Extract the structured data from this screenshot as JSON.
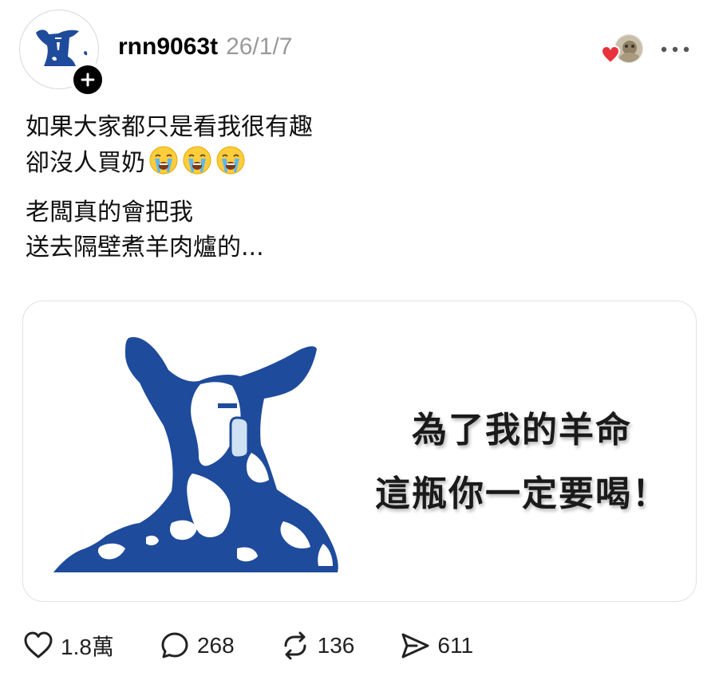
{
  "post": {
    "username": "rnn9063t",
    "timestamp": "26/1/7",
    "text_paragraphs": [
      {
        "lines": [
          "如果大家都只是看我很有趣",
          "卻沒人買奶"
        ],
        "emoji": "😭😭😭"
      },
      {
        "lines": [
          "老闆真的會把我",
          "送去隔壁煮羊肉爐的..."
        ]
      }
    ],
    "image_caption": [
      "為了我的羊命",
      "這瓶你一定要喝！"
    ]
  },
  "actions": {
    "like_count": "1.8萬",
    "reply_count": "268",
    "repost_count": "136",
    "share_count": "611"
  },
  "colors": {
    "brand_blue": "#1e4b9b",
    "heart_red": "#e8323c",
    "muted_text": "#9a9a9a"
  },
  "icons": [
    "goat-logo-icon",
    "plus-icon",
    "heart-icon",
    "more-icon",
    "reply-icon",
    "repost-icon",
    "share-icon",
    "crying-emoji-icon"
  ]
}
